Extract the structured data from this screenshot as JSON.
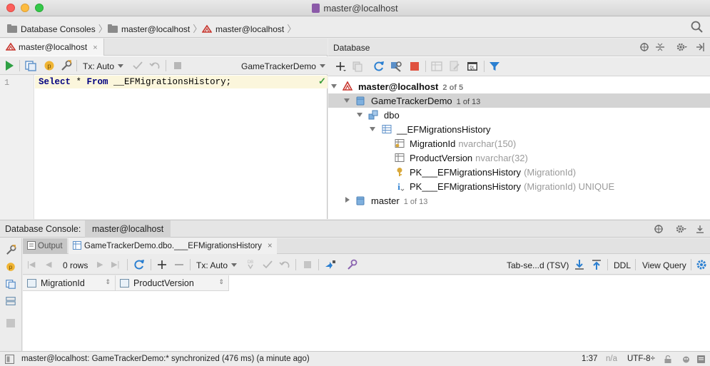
{
  "window": {
    "title": "master@localhost"
  },
  "breadcrumb": {
    "items": [
      {
        "label": "Database Consoles",
        "icon": "folder-icon"
      },
      {
        "label": "master@localhost",
        "icon": "folder-icon"
      },
      {
        "label": "master@localhost",
        "icon": "sql-server-icon"
      }
    ]
  },
  "editor": {
    "tab_label": "master@localhost",
    "tab_close": "×",
    "tx_mode": "Tx: Auto",
    "schema": "GameTrackerDemo",
    "line_number": "1",
    "code": {
      "kw1": "Select",
      "star": " * ",
      "kw2": "From",
      "rest": " __EFMigrationsHistory;"
    },
    "status_check": "✓"
  },
  "database_panel": {
    "title": "Database",
    "tree": {
      "root": {
        "label": "master@localhost",
        "meta": "2 of 5"
      },
      "db": {
        "label": "GameTrackerDemo",
        "meta": "1 of 13"
      },
      "schema": {
        "label": "dbo"
      },
      "table": {
        "label": "__EFMigrationsHistory"
      },
      "col1": {
        "label": "MigrationId",
        "type": "nvarchar(150)"
      },
      "col2": {
        "label": "ProductVersion",
        "type": "nvarchar(32)"
      },
      "key": {
        "label": "PK___EFMigrationsHistory",
        "type": "(MigrationId)"
      },
      "index": {
        "label": "PK___EFMigrationsHistory",
        "type": "(MigrationId) UNIQUE"
      },
      "other_db": {
        "label": "master",
        "meta": "1 of 13"
      }
    }
  },
  "console": {
    "title": "Database Console:",
    "tab_label": "master@localhost",
    "output_tab": "Output",
    "result_tab": "GameTrackerDemo.dbo.___EFMigrationsHistory",
    "result_close": "×",
    "rows": "0 rows",
    "tx_mode": "Tx: Auto",
    "format": "Tab-se...d (TSV)",
    "ddl": "DDL",
    "view_query": "View Query",
    "columns": [
      "MigrationId",
      "ProductVersion"
    ]
  },
  "statusbar": {
    "message": "master@localhost: GameTrackerDemo:* synchronized (476 ms) (a minute ago)",
    "position": "1:37",
    "na": "n/a",
    "encoding": "UTF-8÷"
  },
  "colors": {
    "run_green": "#2ea043",
    "stop_red": "#e0513f",
    "refresh_blue": "#2a7fd1",
    "table_blue": "#5b8fc8",
    "key_gold": "#d9a83a",
    "selection": "#d4d4d4",
    "sql_server_red": "#c8362e"
  }
}
